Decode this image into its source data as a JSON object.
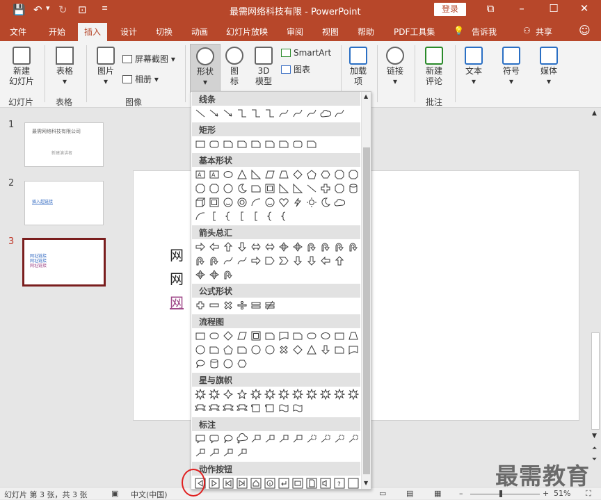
{
  "window": {
    "doc_title": "最需网络科技有限  -  PowerPoint",
    "login": "登录",
    "undo_icon": "↶",
    "redo_icon": "↻"
  },
  "tabs": [
    {
      "label": "文件"
    },
    {
      "label": "开始"
    },
    {
      "label": "插入",
      "active": true
    },
    {
      "label": "设计"
    },
    {
      "label": "切换"
    },
    {
      "label": "动画"
    },
    {
      "label": "幻灯片放映"
    },
    {
      "label": "审阅"
    },
    {
      "label": "视图"
    },
    {
      "label": "帮助"
    },
    {
      "label": "PDF工具集"
    },
    {
      "label": "告诉我"
    },
    {
      "label": "共享"
    }
  ],
  "ribbon": {
    "new_slide": "新建\n幻灯片",
    "table": "表格",
    "picture": "图片",
    "screenshot": "屏幕截图",
    "album": "相册",
    "shapes": "形状",
    "icons": "图\n标",
    "model3d": "3D\n模型",
    "smartart": "SmartArt",
    "chart": "图表",
    "addins": "加载\n项",
    "link": "链接",
    "new_comment": "新建\n评论",
    "text": "文本",
    "symbol": "符号",
    "media": "媒体",
    "groups": {
      "slides": "幻灯片",
      "tables": "表格",
      "images": "图像",
      "comments": "批注"
    }
  },
  "slides": [
    {
      "num": "1",
      "title": "最需网络科技有限公司",
      "subtitle": "新建演讲者"
    },
    {
      "num": "2",
      "link": "插入超链接"
    },
    {
      "num": "3",
      "lines": [
        "网址链接",
        "网址链接",
        "网址链接"
      ]
    }
  ],
  "slide_text": [
    "网",
    "网",
    "网"
  ],
  "shape_menu": {
    "categories": [
      "线条",
      "矩形",
      "基本形状",
      "箭头总汇",
      "公式形状",
      "流程图",
      "星与旗帜",
      "标注",
      "动作按钮"
    ]
  },
  "status": {
    "slide_info": "幻灯片 第 3 张，共 3 张",
    "language": "中文(中国)",
    "zoom": "51%",
    "zoom_level": 0.51
  },
  "watermark": "最需教育",
  "colors": {
    "accent": "#b7472a",
    "selection": "#7a1e1e",
    "highlight": "#e02020"
  }
}
